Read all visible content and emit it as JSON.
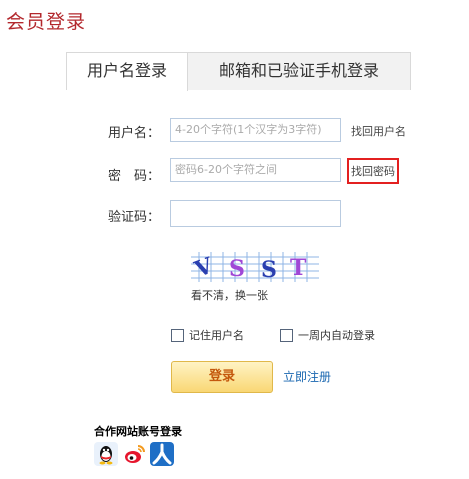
{
  "page": {
    "title": "会员登录"
  },
  "tabs": [
    {
      "label": "用户名登录",
      "active": true
    },
    {
      "label": "邮箱和已验证手机登录",
      "active": false
    }
  ],
  "form": {
    "username_label": "用户名：",
    "username_placeholder": "4-20个字符(1个汉字为3字符)",
    "find_username": "找回用户名",
    "password_label": "密　码：",
    "password_placeholder": "密码6-20个字符之间",
    "find_password": "找回密码",
    "captcha_label": "验证码：",
    "captcha_chars": [
      "V",
      "S",
      "S",
      "T"
    ],
    "captcha_refresh": "看不清，换一张",
    "remember_username": "记住用户名",
    "auto_login_week": "一周内自动登录",
    "login_button": "登录",
    "register_link": "立即注册"
  },
  "partner": {
    "title": "合作网站账号登录",
    "icons": [
      "qq-icon",
      "weibo-icon",
      "renren-icon"
    ]
  },
  "colors": {
    "title": "#b3282d",
    "highlight": "#e32020",
    "link": "#1a67b0",
    "button_text": "#c4580d"
  }
}
